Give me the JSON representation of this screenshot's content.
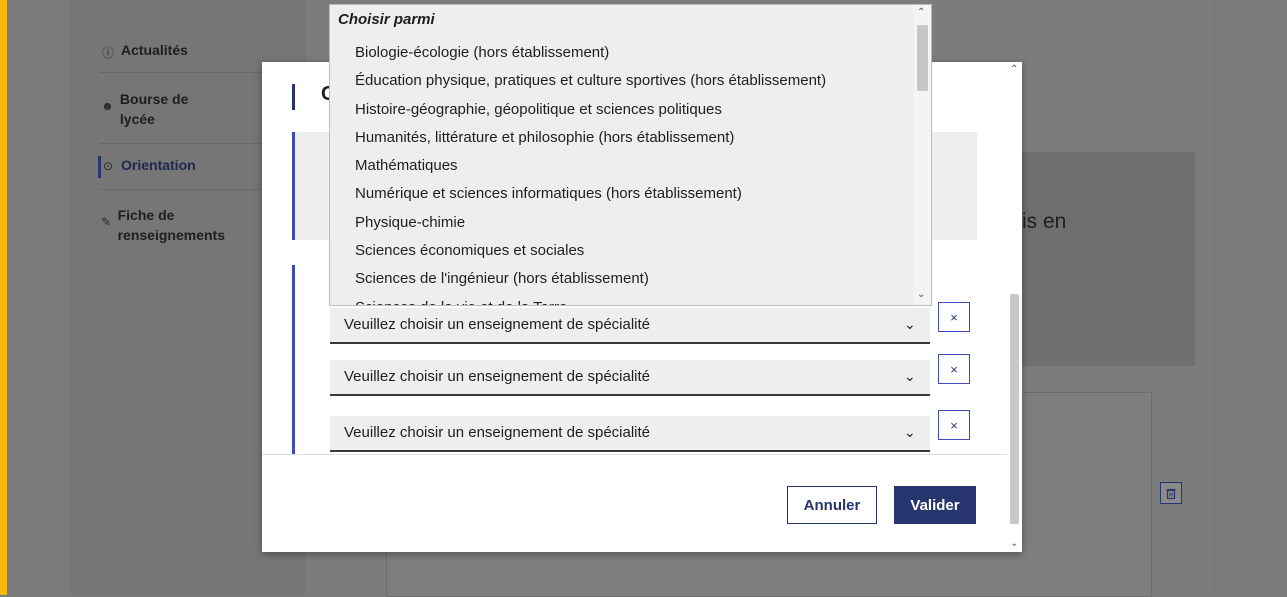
{
  "sidebar": {
    "items": [
      {
        "label": "Actualités",
        "icon": "info-circle-icon"
      },
      {
        "label": "Bourse de lycée",
        "icon": "people-icon"
      },
      {
        "label": "Orientation",
        "icon": "compass-icon"
      },
      {
        "label": "Fiche de renseignements",
        "icon": "edit-icon"
      }
    ]
  },
  "background": {
    "card_text": "is en"
  },
  "modal": {
    "title": "C",
    "selects": [
      {
        "placeholder": "Veuillez choisir un enseignement de spécialité"
      },
      {
        "placeholder": "Veuillez choisir un enseignement de spécialité"
      },
      {
        "placeholder": "Veuillez choisir un enseignement de spécialité"
      }
    ],
    "remove_label": "×",
    "cancel_label": "Annuler",
    "ok_label": "Valider"
  },
  "dropdown": {
    "header": "Choisir parmi",
    "options": [
      "Biologie-écologie (hors établissement)",
      "Éducation physique, pratiques et culture sportives (hors établissement)",
      "Histoire-géographie, géopolitique et sciences politiques",
      "Humanités, littérature et philosophie (hors établissement)",
      "Mathématiques",
      "Numérique et sciences informatiques (hors établissement)",
      "Physique-chimie",
      "Sciences économiques et sociales",
      "Sciences de l'ingénieur (hors établissement)",
      "Sciences de la vie et de la Terre"
    ]
  },
  "colors": {
    "accent": "#27356e",
    "bar": "#3d4bb8",
    "left_border": "#f5b80a"
  }
}
